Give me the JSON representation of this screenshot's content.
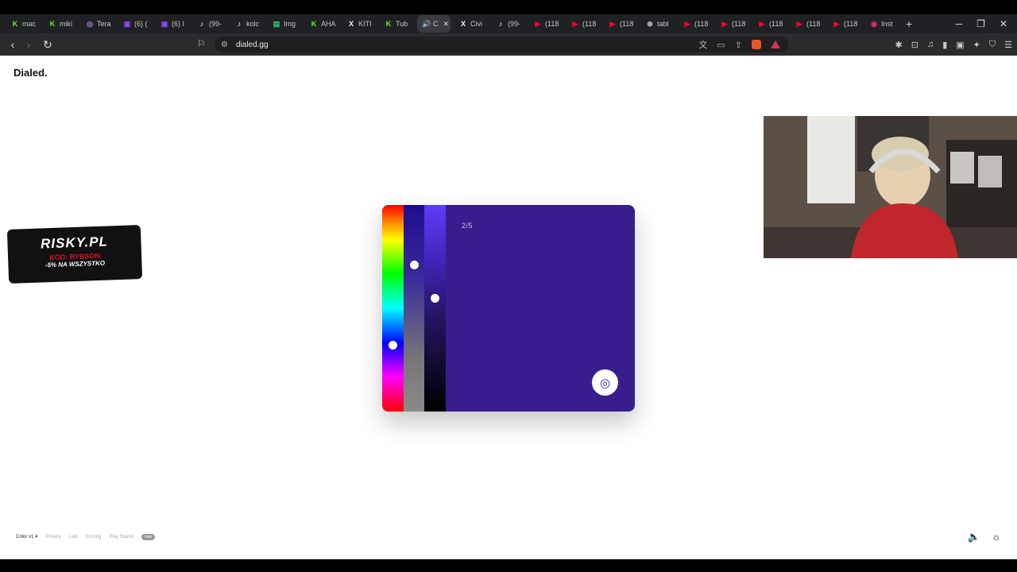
{
  "browser": {
    "tabs": [
      {
        "icon": "K",
        "label": "mac",
        "color": "#53fc18"
      },
      {
        "icon": "K",
        "label": "miki",
        "color": "#53fc18"
      },
      {
        "icon": "◎",
        "label": "Tera",
        "color": "#b47ff0"
      },
      {
        "icon": "▣",
        "label": "(6) (",
        "color": "#9146ff"
      },
      {
        "icon": "▣",
        "label": "(6) I",
        "color": "#9146ff"
      },
      {
        "icon": "♪",
        "label": "(99-",
        "color": "#ffffff"
      },
      {
        "icon": "♪",
        "label": "kolc",
        "color": "#ffffff"
      },
      {
        "icon": "▤",
        "label": "Img",
        "color": "#2fd07a"
      },
      {
        "icon": "K",
        "label": "AHA",
        "color": "#53fc18"
      },
      {
        "icon": "X",
        "label": "KITI",
        "color": "#ffffff"
      },
      {
        "icon": "K",
        "label": "Tub",
        "color": "#53fc18"
      },
      {
        "icon": "🔊",
        "label": "C",
        "color": "#ffffff",
        "active": true
      },
      {
        "icon": "X",
        "label": "Civi",
        "color": "#ffffff"
      },
      {
        "icon": "♪",
        "label": "(99-",
        "color": "#ffffff"
      },
      {
        "icon": "▶",
        "label": "(118",
        "color": "#ff0033"
      },
      {
        "icon": "▶",
        "label": "(118",
        "color": "#ff0033"
      },
      {
        "icon": "▶",
        "label": "(118",
        "color": "#ff0033"
      },
      {
        "icon": "⊕",
        "label": "tabl",
        "color": "#cccccc"
      },
      {
        "icon": "▶",
        "label": "(118",
        "color": "#ff0033"
      },
      {
        "icon": "▶",
        "label": "(118",
        "color": "#ff0033"
      },
      {
        "icon": "▶",
        "label": "(118",
        "color": "#ff0033"
      },
      {
        "icon": "▶",
        "label": "(118",
        "color": "#ff0033"
      },
      {
        "icon": "▶",
        "label": "(118",
        "color": "#ff0033"
      },
      {
        "icon": "◉",
        "label": "Inst",
        "color": "#e1306c"
      }
    ],
    "new_tab": "+",
    "url": "dialed.gg"
  },
  "page": {
    "logo": "Dialed.",
    "round": "2/5",
    "colors": {
      "target": "#381e8c"
    },
    "sliders": {
      "hue_pct": 68,
      "saturation_pct": 29,
      "lightness_pct": 45
    }
  },
  "ad": {
    "brand": "RISKY.PL",
    "code": "KOD: RYBSON",
    "promo": "-5% NA WSZYSTKO"
  },
  "footer": {
    "version": "Color v1.4",
    "links": [
      "Privacy",
      "Lab",
      "Scoring",
      "Play Sound"
    ],
    "badge": "new"
  }
}
